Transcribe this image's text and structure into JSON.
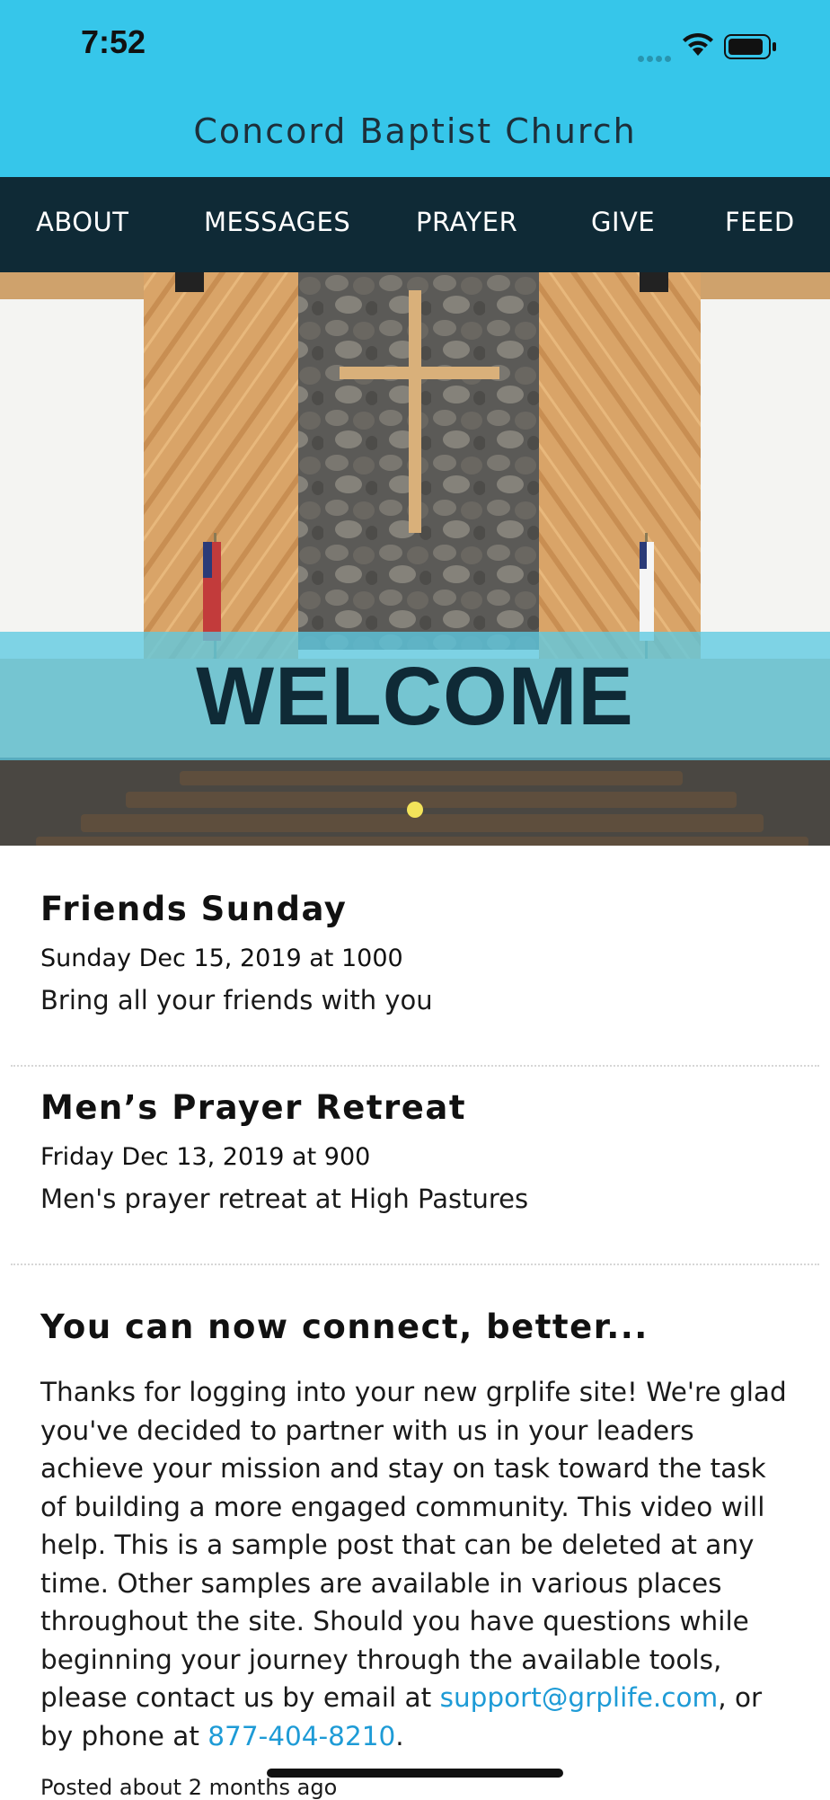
{
  "status_bar": {
    "time": "7:52"
  },
  "header": {
    "title": "Concord Baptist Church"
  },
  "nav": {
    "items": [
      "ABOUT",
      "MESSAGES",
      "PRAYER",
      "GIVE",
      "FEED"
    ]
  },
  "hero": {
    "banner_text": "WELCOME",
    "slide_count": 1,
    "active_slide": 1,
    "indicator_color": "#f3e35a"
  },
  "events": [
    {
      "title": "Friends Sunday",
      "date": "Sunday Dec 15, 2019 at 1000",
      "description": "Bring all your friends with you"
    },
    {
      "title": "Men’s Prayer Retreat",
      "date": "Friday Dec 13, 2019 at 900",
      "description": "Men's prayer retreat at High Pastures"
    }
  ],
  "post": {
    "title": "You can now connect, better...",
    "body_intro": "Thanks for logging into your new grplife site! We're glad you've decided to partner with us in your leaders achieve your mission and stay on task toward the task of building a more engaged community. This video will help. This is a sample post that can be deleted at any time. Other samples are available in various places throughout the site. Should you have questions while beginning your journey through the available tools, please contact us by email at ",
    "email": "support@grplife.com",
    "phone_prefix": ", or by phone at ",
    "phone": "877-404-8210",
    "end": ".",
    "posted": "Posted about 2 months ago"
  },
  "colors": {
    "header_bg": "#36c6ea",
    "nav_bg": "#0f2a36",
    "link": "#1e9bd6"
  }
}
